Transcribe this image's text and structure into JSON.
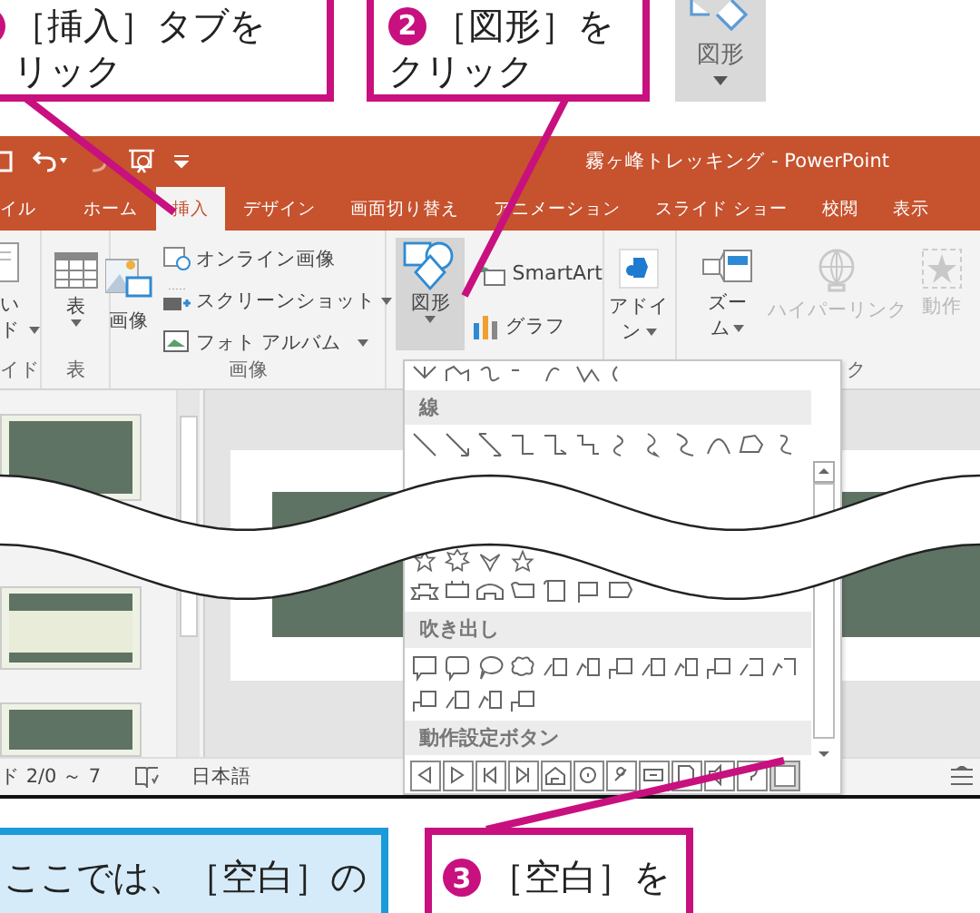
{
  "top_callouts": [
    {
      "lines": [
        "［挿入］タブを",
        "リック"
      ]
    },
    {
      "number": "2",
      "lines": [
        "［図形］を",
        "クリック"
      ]
    }
  ],
  "enlarged_button": {
    "label": "図形"
  },
  "window": {
    "title": "霧ヶ峰トレッキング - PowerPoint"
  },
  "tabs": [
    {
      "label": "イル",
      "selected": false
    },
    {
      "label": "ホーム",
      "selected": false
    },
    {
      "label": "挿入",
      "selected": true
    },
    {
      "label": "デザイン",
      "selected": false
    },
    {
      "label": "画面切り替え",
      "selected": false
    },
    {
      "label": "アニメーション",
      "selected": false
    },
    {
      "label": "スライド ショー",
      "selected": false
    },
    {
      "label": "校閲",
      "selected": false
    },
    {
      "label": "表示",
      "selected": false
    }
  ],
  "ribbon": {
    "slide_group": {
      "lines": [
        "い",
        "ド"
      ],
      "group_label": "イド"
    },
    "table": {
      "label": "表",
      "group_label": "表"
    },
    "images": {
      "picture": "画像",
      "online": "オンライン画像",
      "screenshot": "スクリーンショット",
      "album": "フォト アルバム",
      "group_label": "画像"
    },
    "shapes": {
      "label": "図形",
      "selected": true
    },
    "smartart": "SmartArt",
    "chart": "グラフ",
    "addins": {
      "lines": [
        "アドイ",
        "ン"
      ]
    },
    "zoom": {
      "lines": [
        "ズー",
        "ム"
      ]
    },
    "hyperlink": {
      "label": "ハイパーリンク",
      "disabled": true
    },
    "action": {
      "label": "動作",
      "disabled": true
    },
    "links_group_label": "ク"
  },
  "gallery": {
    "sections": [
      {
        "title": "線"
      },
      {
        "title": "吹き出し"
      },
      {
        "title": "動作設定ボタン"
      }
    ],
    "action_buttons": [
      {
        "selected": false
      },
      {
        "selected": false
      },
      {
        "selected": false
      },
      {
        "selected": false
      },
      {
        "selected": false
      },
      {
        "selected": false
      },
      {
        "selected": false
      },
      {
        "selected": false
      },
      {
        "selected": false
      },
      {
        "selected": false
      },
      {
        "selected": false
      },
      {
        "selected": true
      }
    ]
  },
  "status_bar": {
    "slide": "ド 2/0 ～ 7",
    "language": "日本語"
  },
  "bottom_callouts": [
    {
      "kind": "note",
      "lines": [
        "ここでは、［空白］の"
      ]
    },
    {
      "kind": "step",
      "number": "3",
      "lines": [
        "［空白］を"
      ]
    }
  ]
}
